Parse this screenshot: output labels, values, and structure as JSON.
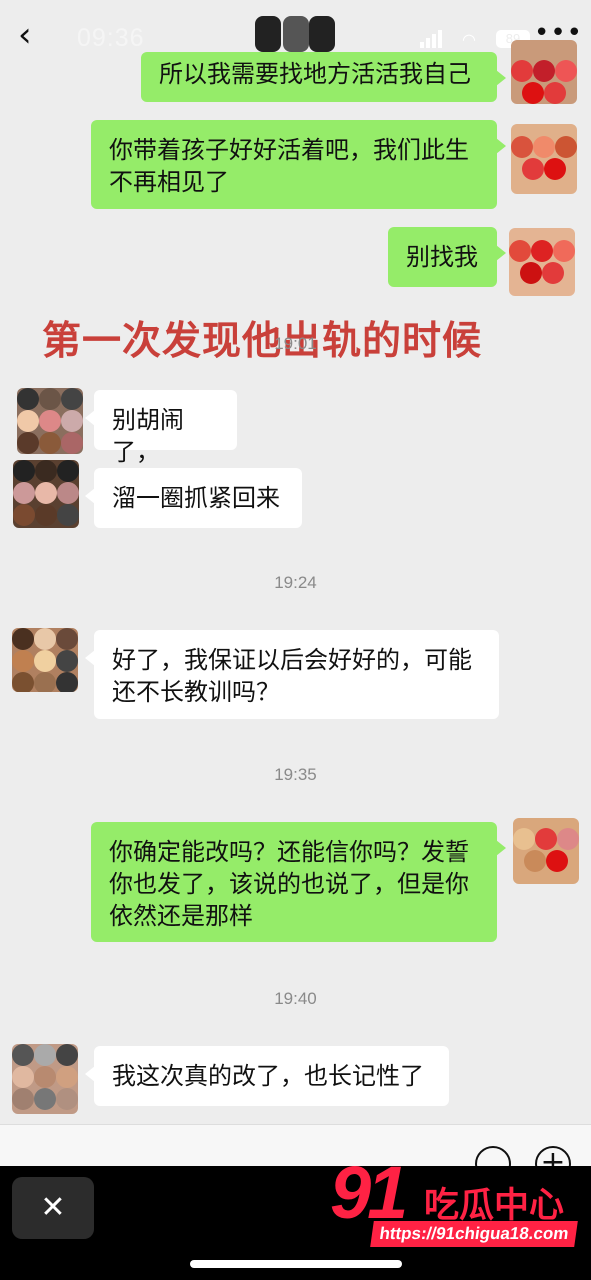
{
  "status_bar": {
    "time": "09:36",
    "battery": "89"
  },
  "header": {
    "back_icon": "chevron-left-icon",
    "more_label": "•••"
  },
  "messages": [
    {
      "side": "right",
      "text": "所以我需要找地方活活我自己"
    },
    {
      "side": "right",
      "text": "你带着孩子好好活着吧，我们此生不再相见了"
    },
    {
      "side": "right",
      "text": "别找我"
    },
    {
      "side": "left",
      "text": "别胡闹了，"
    },
    {
      "side": "left",
      "text": "溜一圈抓紧回来"
    },
    {
      "side": "left",
      "text": "好了，我保证以后会好好的，可能还不长教训吗？"
    },
    {
      "side": "right",
      "text": "你确定能改吗？还能信你吗？发誓你也发了，该说的也说了，但是你依然还是那样"
    },
    {
      "side": "left",
      "text": "我这次真的改了，也长记性了"
    }
  ],
  "timestamps": [
    "19:01",
    "19:24",
    "19:35",
    "19:40"
  ],
  "overlay_caption": "第一次发现他出轨的时候",
  "input_bar": {
    "emoji_icon": "smiley-icon",
    "plus_label": "+"
  },
  "bottom_bar": {
    "close_label": "✕"
  },
  "watermark": {
    "number": "91",
    "name": "吃瓜中心",
    "url": "https://91chigua18.com"
  },
  "colors": {
    "sent_bubble": "#95ec69",
    "received_bubble": "#ffffff",
    "background": "#ededed",
    "caption": "#c9403a",
    "watermark": "#ff2244"
  }
}
